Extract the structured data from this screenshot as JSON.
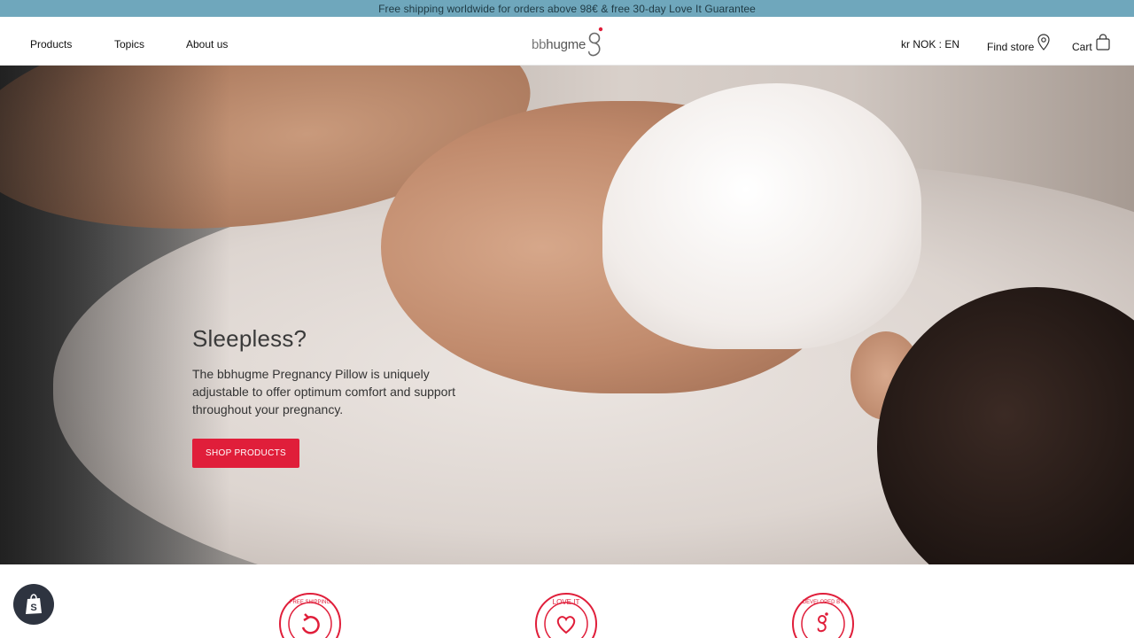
{
  "announcement": "Free shipping worldwide for orders above 98€ & free 30-day Love It Guarantee",
  "nav": {
    "left": [
      "Products",
      "Topics",
      "About us"
    ],
    "logo_prefix": "bb",
    "logo_main": "hugme",
    "logo_mark": "g",
    "currency": "kr NOK : EN",
    "find_store": "Find store",
    "cart": "Cart"
  },
  "hero": {
    "title": "Sleepless?",
    "text": "The bbhugme Pregnancy Pillow is uniquely adjustable to offer optimum comfort and support throughout your pregnancy.",
    "button": "SHOP PRODUCTS"
  },
  "badges": [
    {
      "label": "FREE SHIPPING",
      "icon": "refresh-icon"
    },
    {
      "label": "LOVE IT",
      "icon": "heart-icon"
    },
    {
      "label": "DEVELOPED BY",
      "icon": "logo-g-icon"
    }
  ],
  "colors": {
    "announcement_bg": "#6fa7bc",
    "accent": "#e01e3a"
  }
}
